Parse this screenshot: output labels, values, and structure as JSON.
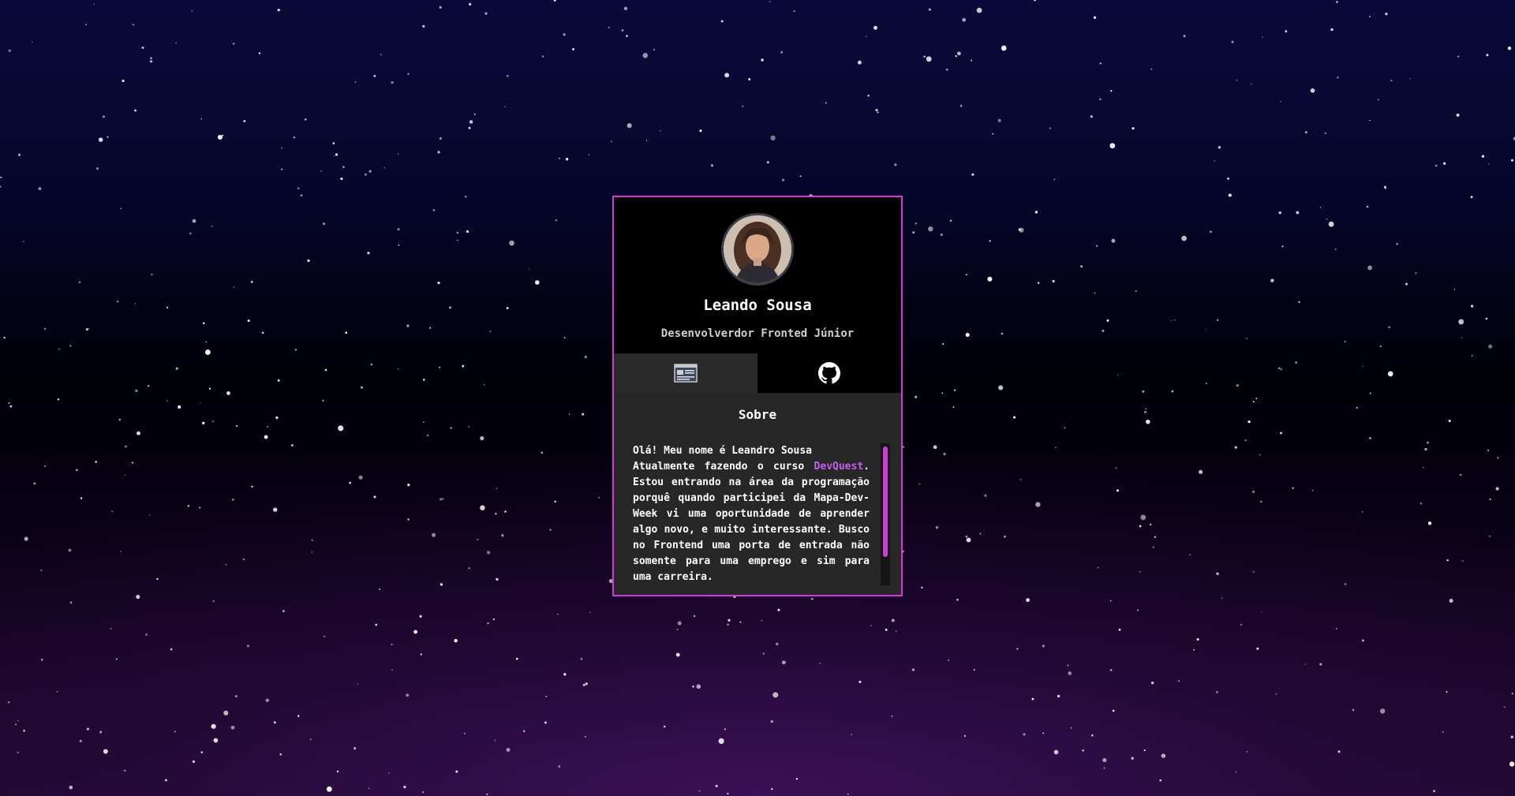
{
  "profile": {
    "name": "Leando Sousa",
    "role": "Desenvolverdor Fronted Júnior",
    "avatar_icon": "portrait-photo"
  },
  "tabs": [
    {
      "icon": "document-icon"
    },
    {
      "icon": "github-icon"
    }
  ],
  "about": {
    "title": "Sobre",
    "bio_line1": "Olá! Meu nome é Leandro Sousa",
    "bio_before_link": "Atualmente fazendo o curso ",
    "bio_link": "DevQuest",
    "bio_after_link": ". Estou entrando na área da programação porquê quando participei da Mapa-Dev-Week vi uma oportunidade de aprender algo novo, e muito interessante. Busco no Frontend uma porta de entrada não somente para uma emprego e sim para uma carreira."
  },
  "colors": {
    "accent": "#d13ad8",
    "link": "#c65cf0",
    "card_background": "#272727",
    "header_background": "#000000"
  }
}
